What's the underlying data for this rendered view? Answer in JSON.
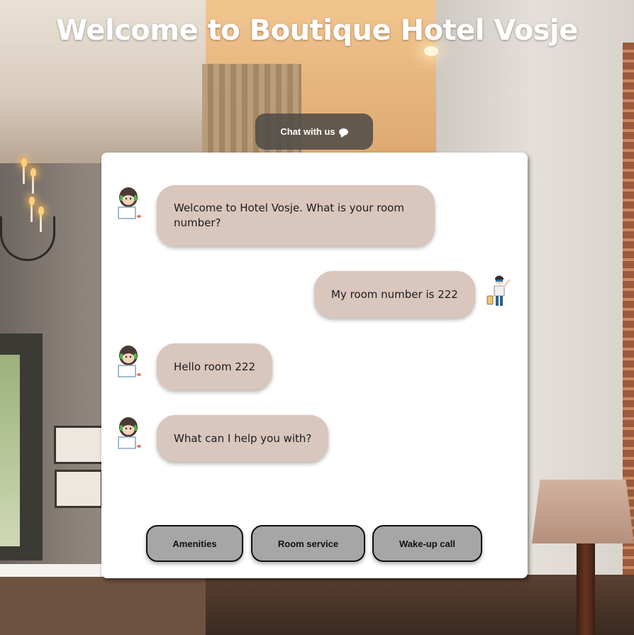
{
  "page": {
    "title": "Welcome to Boutique Hotel Vosje"
  },
  "chat_toggle": {
    "label": "Chat with us",
    "icon": "speech-bubble-icon"
  },
  "conversation": {
    "messages": [
      {
        "sender": "bot",
        "avatar": "receptionist-avatar-icon",
        "text": "Welcome to Hotel Vosje. What is your room number?"
      },
      {
        "sender": "user",
        "avatar": "traveler-avatar-icon",
        "text": "My room number is 222"
      },
      {
        "sender": "bot",
        "avatar": "receptionist-avatar-icon",
        "text": "Hello room 222"
      },
      {
        "sender": "bot",
        "avatar": "receptionist-avatar-icon",
        "text": "What can I help you with?"
      }
    ]
  },
  "quick_replies": [
    {
      "label": "Amenities"
    },
    {
      "label": "Room service"
    },
    {
      "label": "Wake-up call"
    }
  ],
  "colors": {
    "bubble": "#d9c6bd",
    "button": "#a6a6a6",
    "panel": "#ffffff",
    "chat_toggle": "#504c48"
  }
}
